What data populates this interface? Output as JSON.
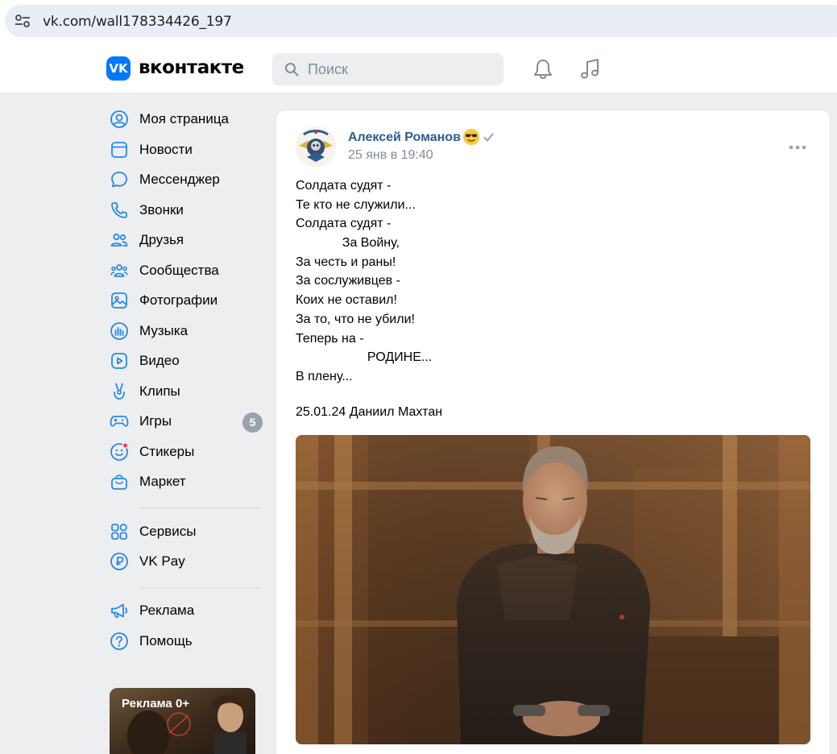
{
  "browser": {
    "url": "vk.com/wall178334426_197"
  },
  "header": {
    "logo_text": "VK",
    "brand": "вконтакте",
    "search_placeholder": "Поиск"
  },
  "sidebar": {
    "items": [
      {
        "label": "Моя страница",
        "icon": "user-circle-icon"
      },
      {
        "label": "Новости",
        "icon": "news-icon"
      },
      {
        "label": "Мессенджер",
        "icon": "message-icon"
      },
      {
        "label": "Звонки",
        "icon": "phone-icon"
      },
      {
        "label": "Друзья",
        "icon": "friends-icon"
      },
      {
        "label": "Сообщества",
        "icon": "communities-icon"
      },
      {
        "label": "Фотографии",
        "icon": "photo-icon"
      },
      {
        "label": "Музыка",
        "icon": "music-wave-icon"
      },
      {
        "label": "Видео",
        "icon": "video-icon"
      },
      {
        "label": "Клипы",
        "icon": "clips-icon"
      },
      {
        "label": "Игры",
        "icon": "gamepad-icon",
        "badge": "5"
      },
      {
        "label": "Стикеры",
        "icon": "sticker-icon"
      },
      {
        "label": "Маркет",
        "icon": "market-bag-icon"
      },
      {
        "label": "Сервисы",
        "icon": "services-grid-icon"
      },
      {
        "label": "VK Pay",
        "icon": "ruble-icon"
      },
      {
        "label": "Реклама",
        "icon": "megaphone-icon"
      },
      {
        "label": "Помощь",
        "icon": "help-icon"
      }
    ],
    "ad_label": "Реклама 0+"
  },
  "post": {
    "author": "Алексей Романов",
    "date": "25 янв в 19:40",
    "lines": [
      "Солдата судят -",
      "Те кто не служили...",
      "Солдата судят -",
      "             За Войну,",
      "За честь и раны!",
      "За сослуживцев -",
      "Коих не оставил!",
      "За то, что не убили!",
      "Теперь на -",
      "                    РОДИНЕ...",
      "В плену..."
    ],
    "signature": "25.01.24 Даниил Махтан"
  },
  "colors": {
    "accent": "#0077ff",
    "author_link": "#2c5d8f",
    "icon_blue": "#2688eb",
    "muted": "#818c99"
  }
}
